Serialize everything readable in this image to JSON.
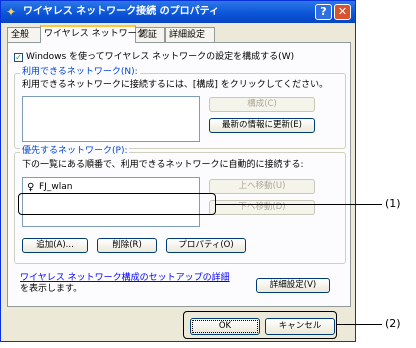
{
  "window": {
    "title": "ワイヤレス ネットワーク接続 のプロパティ",
    "help_button": "?",
    "close_button": "✕"
  },
  "tabs": [
    {
      "label": "全般",
      "active": false
    },
    {
      "label": "ワイヤレス ネットワーク",
      "active": true
    },
    {
      "label": "認証",
      "active": false
    },
    {
      "label": "詳細設定",
      "active": false
    }
  ],
  "panel": {
    "use_windows_checkbox": {
      "label": "Windows を使ってワイヤレス ネットワークの設定を構成する(W)",
      "checked": true
    },
    "available": {
      "group_label": "利用できるネットワーク(N):",
      "description": "利用できるネットワークに接続するには、[構成] をクリックしてください。",
      "configure_button": "構成(C)",
      "refresh_button": "最新の情報に更新(E)"
    },
    "preferred": {
      "group_label": "優先するネットワーク(P):",
      "description": "下の一覧にある順番で、利用できるネットワークに自動的に接続する:",
      "networks": [
        {
          "name": "FJ_wlan",
          "icon": "wireless-network-icon"
        }
      ],
      "move_up_button": "上へ移動(U)",
      "move_down_button": "下へ移動(D)",
      "add_button": "追加(A)...",
      "remove_button": "削除(R)",
      "properties_button": "プロパティ(O)"
    },
    "setup_link_line1": "ワイヤレス ネットワーク構成のセットアップの詳細",
    "setup_link_line2": "を表示します。",
    "advanced_button": "詳細設定(V)"
  },
  "footer": {
    "ok_button": "OK",
    "cancel_button": "キャンセル"
  },
  "callouts": {
    "label_1": "(1)",
    "label_2": "(2)"
  }
}
